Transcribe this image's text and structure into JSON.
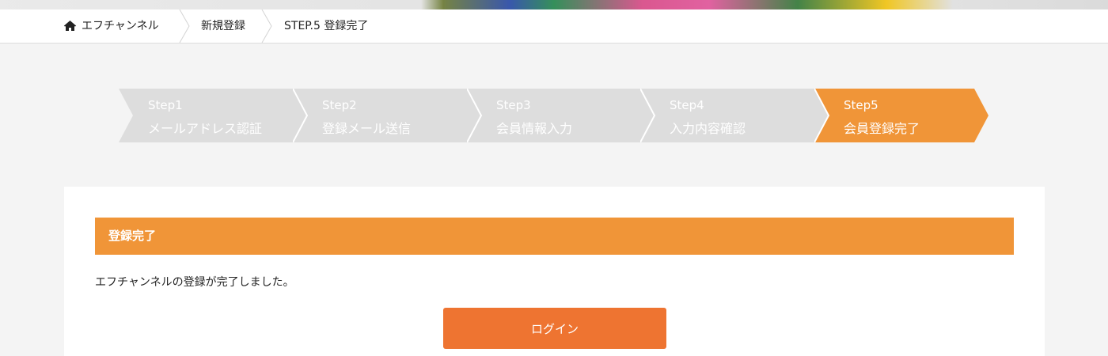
{
  "breadcrumb": {
    "items": [
      "エフチャンネル",
      "新規登録",
      "STEP.5 登録完了"
    ]
  },
  "steps": [
    {
      "num": "Step1",
      "label": "メールアドレス認証",
      "active": false
    },
    {
      "num": "Step2",
      "label": "登録メール送信",
      "active": false
    },
    {
      "num": "Step3",
      "label": "会員情報入力",
      "active": false
    },
    {
      "num": "Step4",
      "label": "入力内容確認",
      "active": false
    },
    {
      "num": "Step5",
      "label": "会員登録完了",
      "active": true
    }
  ],
  "colors": {
    "accent": "#f09538",
    "button": "#ee7431",
    "step_inactive": "#dddddd",
    "page_bg": "#f4f4f4"
  },
  "main": {
    "section_title": "登録完了",
    "message": "エフチャンネルの登録が完了しました。",
    "login_label": "ログイン"
  }
}
